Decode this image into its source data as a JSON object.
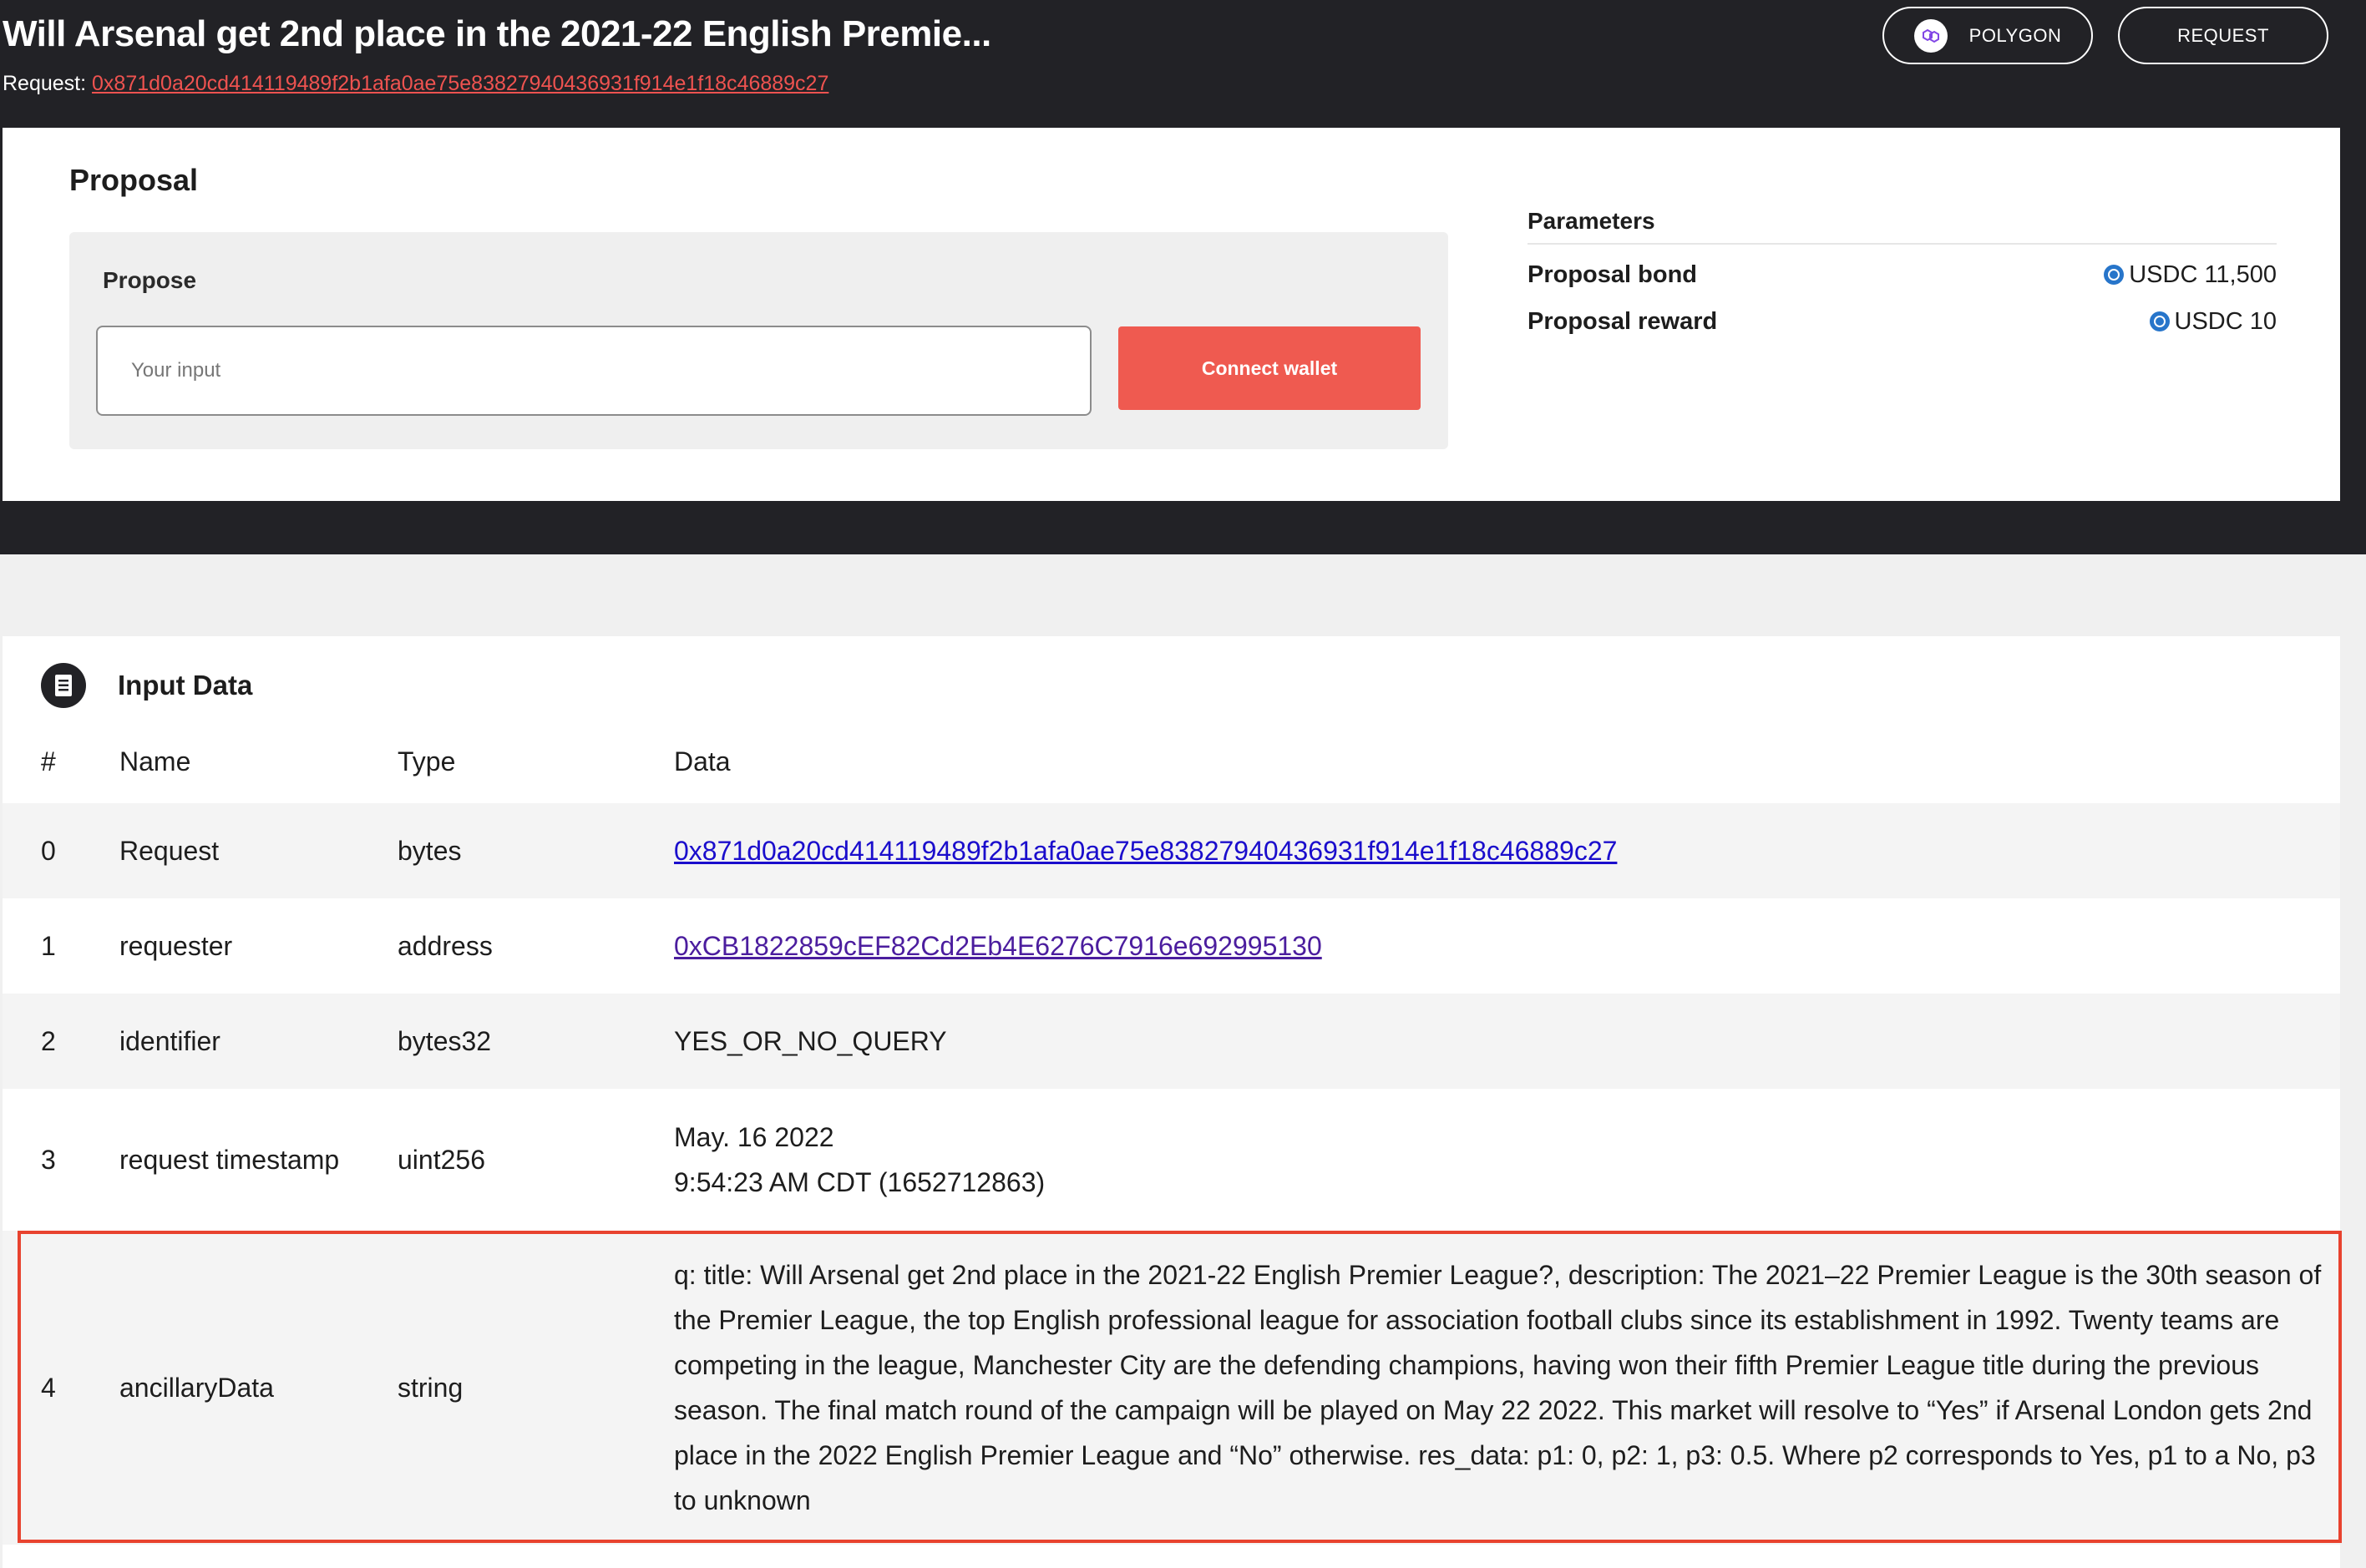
{
  "header": {
    "title": "Will Arsenal get 2nd place in the 2021-22 English Premie...",
    "request_label": "Request:",
    "request_hash": "0x871d0a20cd414119489f2b1afa0ae75e83827940436931f914e1f18c46889c27",
    "polygon_button": "POLYGON",
    "request_button": "REQUEST"
  },
  "proposal": {
    "title": "Proposal",
    "propose_label": "Propose",
    "input_placeholder": "Your input",
    "connect_button": "Connect wallet"
  },
  "parameters": {
    "title": "Parameters",
    "rows": [
      {
        "name": "Proposal bond",
        "value": "USDC 11,500"
      },
      {
        "name": "Proposal reward",
        "value": "USDC 10"
      }
    ]
  },
  "input_data": {
    "title": "Input Data",
    "columns": {
      "index": "#",
      "name": "Name",
      "type": "Type",
      "data": "Data"
    },
    "rows": [
      {
        "index": "0",
        "name": "Request",
        "type": "bytes",
        "data": "0x871d0a20cd414119489f2b1afa0ae75e83827940436931f914e1f18c46889c27"
      },
      {
        "index": "1",
        "name": "requester",
        "type": "address",
        "data": "0xCB1822859cEF82Cd2Eb4E6276C7916e692995130"
      },
      {
        "index": "2",
        "name": "identifier",
        "type": "bytes32",
        "data": "YES_OR_NO_QUERY"
      },
      {
        "index": "3",
        "name": "request timestamp",
        "type": "uint256",
        "data_line1": "May. 16 2022",
        "data_line2": "9:54:23 AM CDT (1652712863)"
      },
      {
        "index": "4",
        "name": "ancillaryData",
        "type": "string",
        "data": "q: title: Will Arsenal get 2nd place in the 2021-22 English Premier League?, description: The 2021–22 Premier League is the 30th season of the Premier League, the top English professional league for association football clubs since its establishment in 1992. Twenty teams are competing in the league, Manchester City are the defending champions, having won their fifth Premier League title during the previous season. The final match round of the campaign will be played on May 22 2022. This market will resolve to “Yes” if Arsenal London gets 2nd place in the 2022 English Premier League and “No” otherwise. res_data: p1: 0, p2: 1, p3: 0.5. Where p2 corresponds to Yes, p1 to a No, p3 to unknown"
      }
    ]
  },
  "colors": {
    "header_bg": "#222226",
    "accent_red": "#ef5a50",
    "link_blue": "#1a0dcc",
    "link_purple": "#4b1d9e",
    "usdc_blue": "#2775ca",
    "highlight_red": "#e8432f"
  },
  "icons": {
    "polygon": "polygon-logo-icon",
    "usdc": "usdc-coin-icon",
    "input_data": "document-icon"
  }
}
